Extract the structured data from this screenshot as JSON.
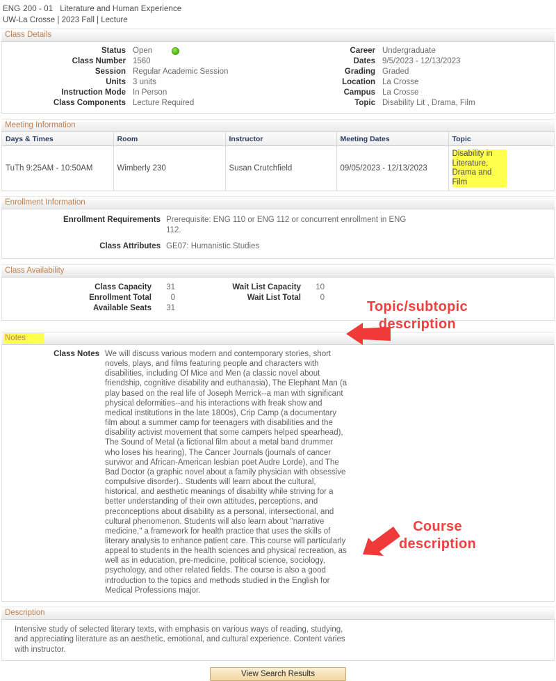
{
  "header": {
    "subject": "ENG",
    "catalog": "200 - 01",
    "title": "Literature and Human Experience",
    "term_line": "UW-La Crosse | 2023 Fall | Lecture"
  },
  "class_details": {
    "section_title": "Class Details",
    "left": [
      {
        "label": "Status",
        "value": "Open",
        "icon": "green-status-dot"
      },
      {
        "label": "Class Number",
        "value": "1560"
      },
      {
        "label": "Session",
        "value": "Regular Academic Session"
      },
      {
        "label": "Units",
        "value": "3 units"
      },
      {
        "label": "Instruction Mode",
        "value": "In Person"
      },
      {
        "label": "Class Components",
        "value": "Lecture Required"
      }
    ],
    "right": [
      {
        "label": "Career",
        "value": "Undergraduate"
      },
      {
        "label": "Dates",
        "value": "9/5/2023 - 12/13/2023"
      },
      {
        "label": "Grading",
        "value": "Graded"
      },
      {
        "label": "Location",
        "value": "La Crosse"
      },
      {
        "label": "Campus",
        "value": "La Crosse"
      },
      {
        "label": "Topic",
        "value": "Disability Lit , Drama, Film"
      }
    ]
  },
  "meeting_information": {
    "section_title": "Meeting Information",
    "columns": [
      "Days & Times",
      "Room",
      "Instructor",
      "Meeting Dates",
      "Topic"
    ],
    "rows": [
      {
        "days_times": "TuTh 9:25AM - 10:50AM",
        "room": "Wimberly 230",
        "instructor": "Susan Crutchfield",
        "meeting_dates": "09/05/2023 - 12/13/2023",
        "topic": "Disability in Literature, Drama and Film",
        "topic_highlighted": true
      }
    ]
  },
  "enrollment_information": {
    "section_title": "Enrollment Information",
    "rows": [
      {
        "label": "Enrollment Requirements",
        "value": "Prerequisite: ENG 110 or ENG 112 or concurrent enrollment in ENG 112."
      },
      {
        "label": "Class Attributes",
        "value": "GE07: Humanistic Studies"
      }
    ]
  },
  "class_availability": {
    "section_title": "Class Availability",
    "left": [
      {
        "label": "Class Capacity",
        "value": "31"
      },
      {
        "label": "Enrollment Total",
        "value": "0"
      },
      {
        "label": "Available Seats",
        "value": "31"
      }
    ],
    "right": [
      {
        "label": "Wait List Capacity",
        "value": "10"
      },
      {
        "label": "Wait List Total",
        "value": "0"
      }
    ]
  },
  "notes": {
    "section_title": "Notes",
    "section_title_highlighted": true,
    "label": "Class Notes",
    "text": "We will discuss various modern and contemporary stories, short novels, plays, and films featuring people and characters with disabilities, including Of Mice and Men (a classic novel about friendship, cognitive disability and euthanasia), The Elephant Man (a play based on the real life of Joseph Merrick--a man with significant physical deformities--and his interactions with freak show and medical institutions in the late 1800s), Crip Camp (a documentary film about a summer camp for teenagers with disabilities and the disability activist movement that some campers helped spearhead), The Sound of Metal (a fictional film about a metal band drummer who loses his hearing), The Cancer Journals (journals of cancer survivor and African-American lesbian poet Audre Lorde), and The Bad Doctor (a graphic novel about a family physician with obsessive compulsive disorder).. Students will learn about the cultural, historical, and aesthetic meanings of disability while striving for a better understanding of their own attitudes, perceptions, and preconceptions about disability as a personal, intersectional, and cultural phenomenon. Students will also learn about \"narrative medicine,\" a framework for health practice that uses the skills of literary analysis to enhance patient care. This course will particularly appeal to students in the health sciences and physical recreation, as well as in education, pre-medicine, political science, sociology, psychology, and other related fields. The course is also a good introduction to the topics and methods studied in the English for Medical Professions major."
  },
  "description": {
    "section_title": "Description",
    "text": "Intensive study of selected literary texts, with emphasis on various ways of reading, studying, and appreciating literature as an aesthetic, emotional, and cultural experience. Content varies with instructor."
  },
  "footer": {
    "view_search_results_label": "View Search Results"
  },
  "annotations": [
    {
      "text": "Topic/subtopic\ndescription",
      "line1": "Topic/subtopic",
      "line2": "description",
      "color": "#f04040"
    },
    {
      "text": "Course\ndescription",
      "line1": "Course",
      "line2": "description",
      "color": "#f04040"
    }
  ]
}
